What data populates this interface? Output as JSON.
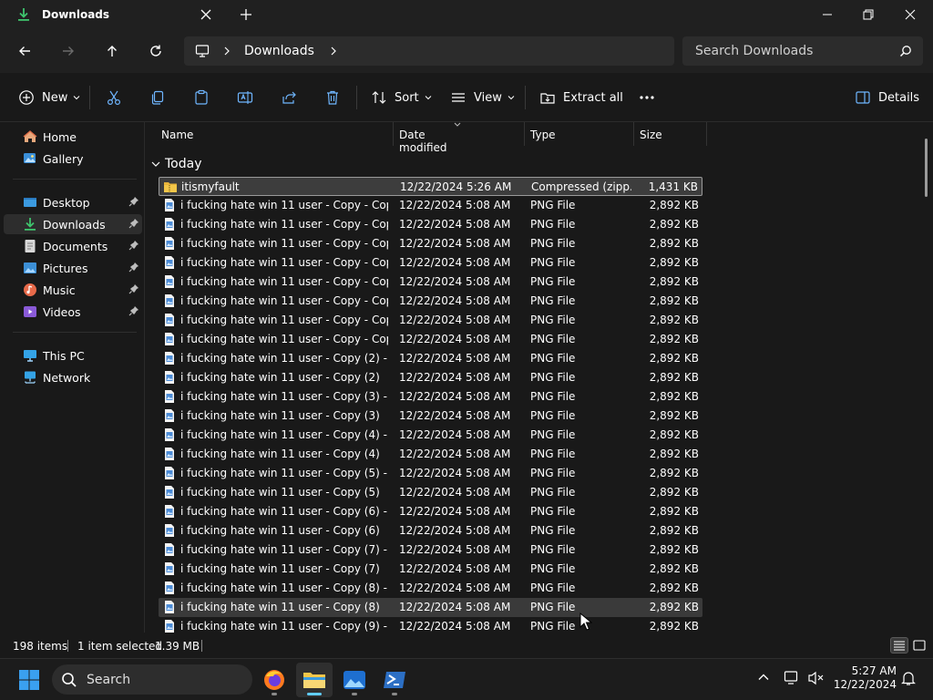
{
  "window": {
    "tab_title": "Downloads"
  },
  "address": {
    "crumb": "Downloads",
    "search_placeholder": "Search Downloads"
  },
  "commands": {
    "new_label": "New",
    "sort_label": "Sort",
    "view_label": "View",
    "extract_label": "Extract all",
    "details_label": "Details"
  },
  "sidebar": {
    "items": [
      {
        "label": "Home",
        "icon": "home-icon"
      },
      {
        "label": "Gallery",
        "icon": "gallery-icon"
      },
      {
        "label": "Desktop",
        "icon": "desktop-icon",
        "pinned": true
      },
      {
        "label": "Downloads",
        "icon": "download-icon",
        "pinned": true,
        "active": true
      },
      {
        "label": "Documents",
        "icon": "documents-icon",
        "pinned": true
      },
      {
        "label": "Pictures",
        "icon": "pictures-icon",
        "pinned": true
      },
      {
        "label": "Music",
        "icon": "music-icon",
        "pinned": true
      },
      {
        "label": "Videos",
        "icon": "videos-icon",
        "pinned": true
      },
      {
        "label": "This PC",
        "icon": "this-pc-icon"
      },
      {
        "label": "Network",
        "icon": "network-icon"
      }
    ]
  },
  "columns": {
    "name": "Name",
    "date": "Date modified",
    "type": "Type",
    "size": "Size"
  },
  "group": {
    "label": "Today"
  },
  "files": [
    {
      "name": "itismyfault",
      "date": "12/22/2024 5:26 AM",
      "type": "Compressed (zipp...",
      "size": "1,431 KB",
      "kind": "zip"
    },
    {
      "name": "i fucking hate win 11 user - Copy - Copy ...",
      "date": "12/22/2024 5:08 AM",
      "type": "PNG File",
      "size": "2,892 KB",
      "kind": "png"
    },
    {
      "name": "i fucking hate win 11 user - Copy - Copy ...",
      "date": "12/22/2024 5:08 AM",
      "type": "PNG File",
      "size": "2,892 KB",
      "kind": "png"
    },
    {
      "name": "i fucking hate win 11 user - Copy - Copy ...",
      "date": "12/22/2024 5:08 AM",
      "type": "PNG File",
      "size": "2,892 KB",
      "kind": "png"
    },
    {
      "name": "i fucking hate win 11 user - Copy - Copy ...",
      "date": "12/22/2024 5:08 AM",
      "type": "PNG File",
      "size": "2,892 KB",
      "kind": "png"
    },
    {
      "name": "i fucking hate win 11 user - Copy - Copy ...",
      "date": "12/22/2024 5:08 AM",
      "type": "PNG File",
      "size": "2,892 KB",
      "kind": "png"
    },
    {
      "name": "i fucking hate win 11 user - Copy - Copy ...",
      "date": "12/22/2024 5:08 AM",
      "type": "PNG File",
      "size": "2,892 KB",
      "kind": "png"
    },
    {
      "name": "i fucking hate win 11 user - Copy - Copy ...",
      "date": "12/22/2024 5:08 AM",
      "type": "PNG File",
      "size": "2,892 KB",
      "kind": "png"
    },
    {
      "name": "i fucking hate win 11 user - Copy - Copy",
      "date": "12/22/2024 5:08 AM",
      "type": "PNG File",
      "size": "2,892 KB",
      "kind": "png"
    },
    {
      "name": "i fucking hate win 11 user - Copy (2) - Co...",
      "date": "12/22/2024 5:08 AM",
      "type": "PNG File",
      "size": "2,892 KB",
      "kind": "png"
    },
    {
      "name": "i fucking hate win 11 user - Copy (2)",
      "date": "12/22/2024 5:08 AM",
      "type": "PNG File",
      "size": "2,892 KB",
      "kind": "png"
    },
    {
      "name": "i fucking hate win 11 user - Copy (3) - Co...",
      "date": "12/22/2024 5:08 AM",
      "type": "PNG File",
      "size": "2,892 KB",
      "kind": "png"
    },
    {
      "name": "i fucking hate win 11 user - Copy (3)",
      "date": "12/22/2024 5:08 AM",
      "type": "PNG File",
      "size": "2,892 KB",
      "kind": "png"
    },
    {
      "name": "i fucking hate win 11 user - Copy (4) - Co...",
      "date": "12/22/2024 5:08 AM",
      "type": "PNG File",
      "size": "2,892 KB",
      "kind": "png"
    },
    {
      "name": "i fucking hate win 11 user - Copy (4)",
      "date": "12/22/2024 5:08 AM",
      "type": "PNG File",
      "size": "2,892 KB",
      "kind": "png"
    },
    {
      "name": "i fucking hate win 11 user - Copy (5) - Co...",
      "date": "12/22/2024 5:08 AM",
      "type": "PNG File",
      "size": "2,892 KB",
      "kind": "png"
    },
    {
      "name": "i fucking hate win 11 user - Copy (5)",
      "date": "12/22/2024 5:08 AM",
      "type": "PNG File",
      "size": "2,892 KB",
      "kind": "png"
    },
    {
      "name": "i fucking hate win 11 user - Copy (6) - Co...",
      "date": "12/22/2024 5:08 AM",
      "type": "PNG File",
      "size": "2,892 KB",
      "kind": "png"
    },
    {
      "name": "i fucking hate win 11 user - Copy (6)",
      "date": "12/22/2024 5:08 AM",
      "type": "PNG File",
      "size": "2,892 KB",
      "kind": "png"
    },
    {
      "name": "i fucking hate win 11 user - Copy (7) - Co...",
      "date": "12/22/2024 5:08 AM",
      "type": "PNG File",
      "size": "2,892 KB",
      "kind": "png"
    },
    {
      "name": "i fucking hate win 11 user - Copy (7)",
      "date": "12/22/2024 5:08 AM",
      "type": "PNG File",
      "size": "2,892 KB",
      "kind": "png"
    },
    {
      "name": "i fucking hate win 11 user - Copy (8) - Co...",
      "date": "12/22/2024 5:08 AM",
      "type": "PNG File",
      "size": "2,892 KB",
      "kind": "png"
    },
    {
      "name": "i fucking hate win 11 user - Copy (8)",
      "date": "12/22/2024 5:08 AM",
      "type": "PNG File",
      "size": "2,892 KB",
      "kind": "png",
      "hovered": true
    },
    {
      "name": "i fucking hate win 11 user - Copy (9) - Co...",
      "date": "12/22/2024 5:08 AM",
      "type": "PNG File",
      "size": "2,892 KB",
      "kind": "png"
    }
  ],
  "status": {
    "count": "198 items",
    "selection": "1 item selected",
    "selection_size": "1.39 MB"
  },
  "taskbar": {
    "search_label": "Search",
    "time": "5:27 AM",
    "date": "12/22/2024"
  },
  "colors": {
    "accent": "#60cdff",
    "folder_yellow": "#f2c649",
    "png_blue": "#4b8bd6",
    "window_bg": "#191919"
  }
}
